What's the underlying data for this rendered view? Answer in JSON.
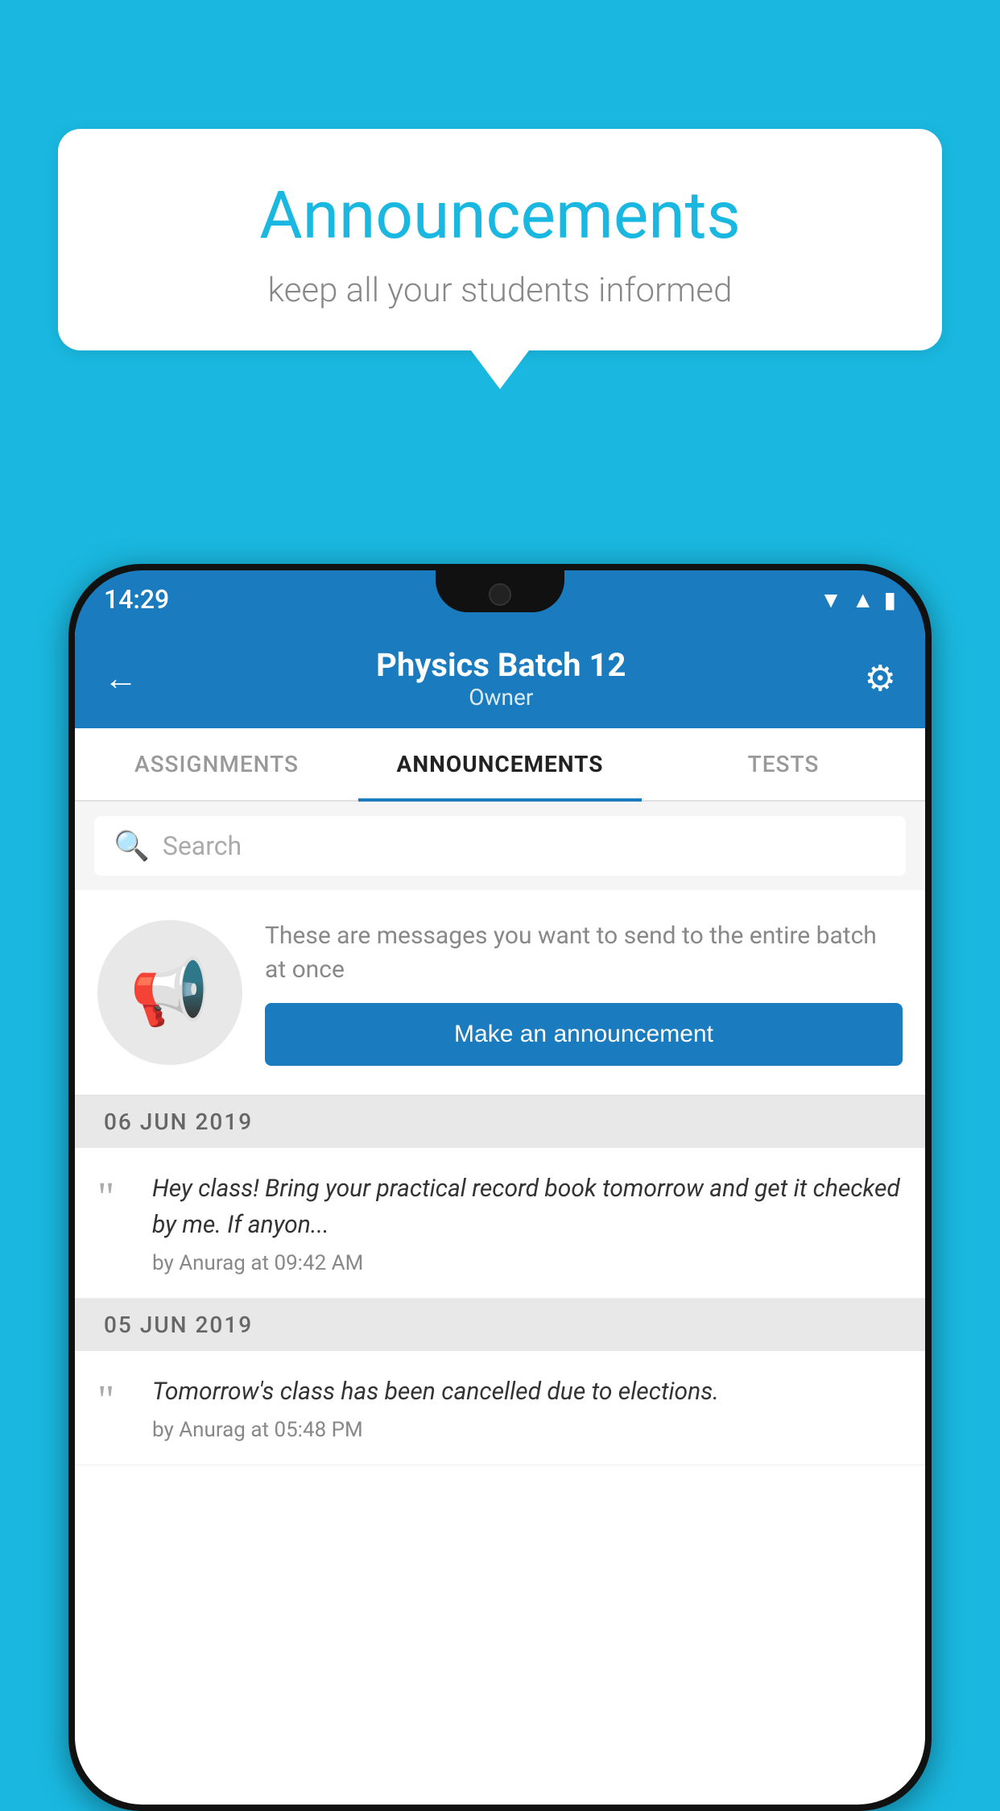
{
  "background_color": "#1ab8e0",
  "speech_bubble": {
    "title": "Announcements",
    "subtitle": "keep all your students informed"
  },
  "phone": {
    "status_bar": {
      "time": "14:29",
      "icons": [
        "wifi",
        "signal",
        "battery"
      ]
    },
    "header": {
      "title": "Physics Batch 12",
      "subtitle": "Owner",
      "back_label": "←",
      "gear_label": "⚙"
    },
    "tabs": [
      {
        "label": "ASSIGNMENTS",
        "active": false
      },
      {
        "label": "ANNOUNCEMENTS",
        "active": true
      },
      {
        "label": "TESTS",
        "active": false
      }
    ],
    "search": {
      "placeholder": "Search"
    },
    "cta": {
      "description": "These are messages you want to send to the entire batch at once",
      "button_label": "Make an announcement"
    },
    "announcements": [
      {
        "date": "06  JUN  2019",
        "text": "Hey class! Bring your practical record book tomorrow and get it checked by me. If anyon...",
        "meta": "by Anurag at 09:42 AM"
      },
      {
        "date": "05  JUN  2019",
        "text": "Tomorrow's class has been cancelled due to elections.",
        "meta": "by Anurag at 05:48 PM"
      }
    ]
  }
}
